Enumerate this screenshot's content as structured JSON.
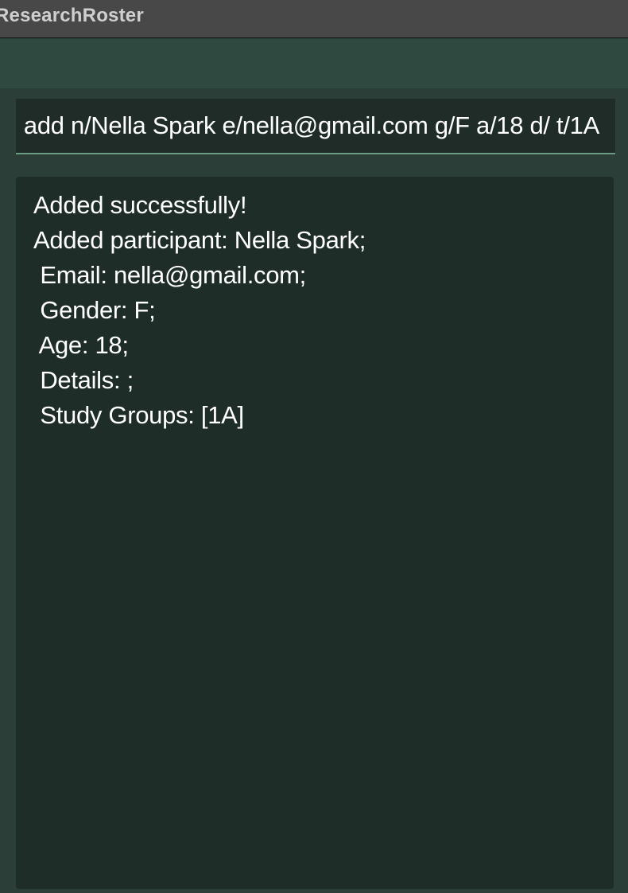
{
  "window": {
    "title": "ResearchRoster"
  },
  "command_box": {
    "value": "add n/Nella Spark e/nella@gmail.com g/F a/18 d/ t/1A"
  },
  "result_display": {
    "lines": [
      "Added successfully!",
      "Added participant: Nella Spark;",
      " Email: nella@gmail.com;",
      " Gender: F;",
      " Age: 18;",
      " Details: ;",
      " Study Groups: [1A]"
    ]
  }
}
